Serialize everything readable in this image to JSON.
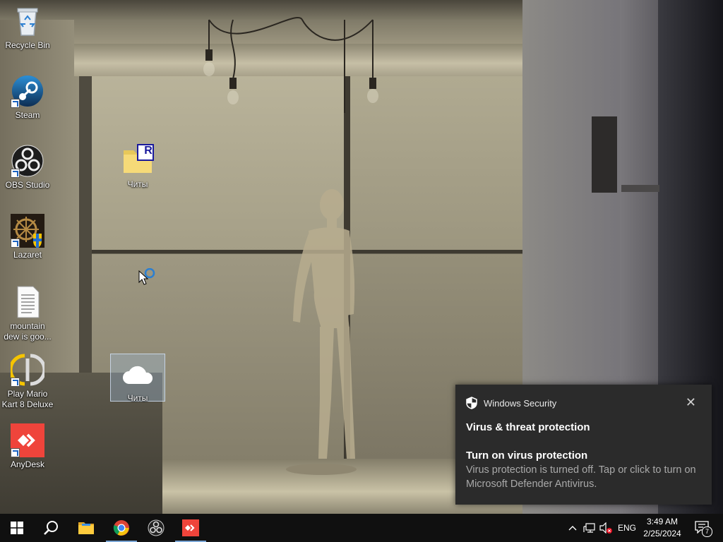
{
  "desktop": {
    "icons_left": [
      {
        "label": "Recycle Bin"
      },
      {
        "label": "Steam"
      },
      {
        "label": "OBS Studio"
      },
      {
        "label": "Lazaret"
      },
      {
        "label": "mountain dew is goo..."
      },
      {
        "label": "Play Mario Kart 8 Deluxe"
      },
      {
        "label": "AnyDesk"
      }
    ],
    "folder_icon": {
      "label": "Читы",
      "badge": "R"
    },
    "onedrive_icon": {
      "label": "Читы"
    }
  },
  "notification": {
    "app_name": "Windows Security",
    "title": "Virus & threat protection",
    "subtitle": "Turn on virus protection",
    "body": "Virus protection is turned off. Tap or click to turn on Microsoft Defender Antivirus.",
    "close_glyph": "✕"
  },
  "taskbar": {
    "pinned": [
      "start-icon",
      "search-icon",
      "file-explorer-icon",
      "chrome-icon",
      "obs-icon",
      "anydesk-icon"
    ],
    "tray": {
      "language": "ENG",
      "time": "3:49 AM",
      "date": "2/25/2024",
      "notification_count": "7"
    }
  },
  "colors": {
    "taskbar": "#101010",
    "toast_bg": "#2b2b2b",
    "accent": "#7aa6d6",
    "anydesk_red": "#ef443b"
  }
}
